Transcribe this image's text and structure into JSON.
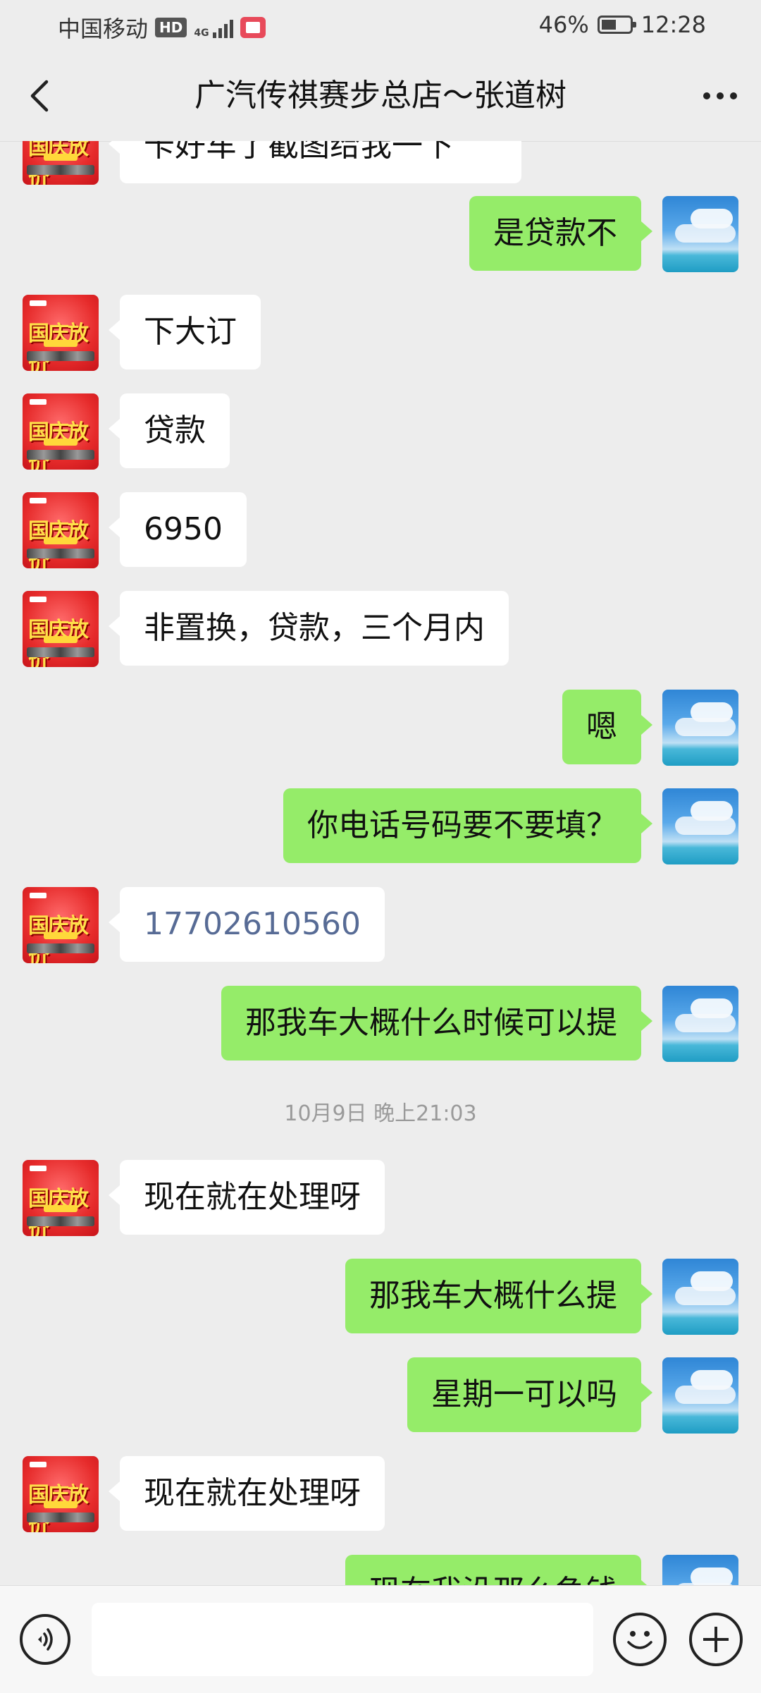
{
  "status_bar": {
    "carrier": "中国移动",
    "hd_badge": "HD",
    "network": "4G",
    "battery": "46%",
    "time": "12:28",
    "icons": [
      "hd-icon",
      "signal-icon",
      "reader-app-icon",
      "battery-icon"
    ]
  },
  "header": {
    "title": "广汽传祺赛步总店～张道树",
    "back_icon": "chevron-left-icon",
    "more_icon": "more-dots-icon"
  },
  "chat": {
    "messages": [
      {
        "from": "them",
        "text": "卡好车了截图给我一下"
      },
      {
        "from": "me",
        "text": "是贷款不"
      },
      {
        "from": "them",
        "text": "下大订"
      },
      {
        "from": "them",
        "text": "贷款"
      },
      {
        "from": "them",
        "text": "6950"
      },
      {
        "from": "them",
        "text": "非置换，贷款，三个月内"
      },
      {
        "from": "me",
        "text": "嗯"
      },
      {
        "from": "me",
        "text": "你电话号码要不要填？"
      },
      {
        "from": "them",
        "text": "17702610560"
      },
      {
        "from": "me",
        "text": "那我车大概什么时候可以提"
      },
      {
        "from": "me",
        "text": "那我车大概什么提"
      },
      {
        "from": "me",
        "text": "星期一可以吗"
      },
      {
        "from": "them",
        "text": "现在就在处理呀"
      },
      {
        "from": "me",
        "text": "现在我没那么急钱"
      }
    ],
    "timestamp": "10月9日 晚上21:03"
  },
  "input_bar": {
    "voice_icon": "voice-icon",
    "emoji_icon": "emoji-icon",
    "plus_icon": "plus-icon",
    "text_value": ""
  }
}
